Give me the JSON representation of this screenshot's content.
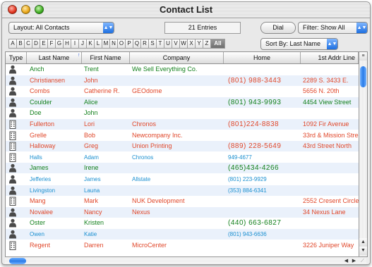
{
  "window": {
    "title": "Contact List"
  },
  "toolbar": {
    "layout_label": "Layout: All Contacts",
    "entries": "21 Entries",
    "dial_label": "Dial",
    "filter_label": "Filter: Show All",
    "sort_label": "Sort By: Last Name"
  },
  "alpha": [
    "A",
    "B",
    "C",
    "D",
    "E",
    "F",
    "G",
    "H",
    "I",
    "J",
    "K",
    "L",
    "M",
    "N",
    "O",
    "P",
    "Q",
    "R",
    "S",
    "T",
    "U",
    "V",
    "W",
    "X",
    "Y",
    "Z",
    "All"
  ],
  "columns": [
    "Type",
    "Last Name",
    "First Name",
    "Company",
    "Home",
    "1st Addr Line"
  ],
  "rows": [
    {
      "type": "person",
      "last": "Anch",
      "first": "Trent",
      "company": "We Sell Everything Co.",
      "home": "",
      "addr": "",
      "color": "#13801c"
    },
    {
      "type": "person",
      "last": "Christiansen",
      "first": "John",
      "company": "",
      "home": "(801) 988-3443",
      "addr": "2289 S. 3433 E.",
      "color": "#e0472a"
    },
    {
      "type": "person",
      "last": "Combs",
      "first": "Catherine R.",
      "company": "GEOdome",
      "home": "",
      "addr": "5656 N. 20th",
      "color": "#e0472a"
    },
    {
      "type": "person",
      "last": "Coulder",
      "first": "Alice",
      "company": "",
      "home": "(801) 943-9993",
      "addr": "4454 View Street",
      "color": "#13801c"
    },
    {
      "type": "person",
      "last": "Doe",
      "first": "John",
      "company": "",
      "home": "",
      "addr": "",
      "color": "#13801c"
    },
    {
      "type": "building",
      "last": "Fullerton",
      "first": "Lori",
      "company": "Chronos",
      "home": "(801)224-8838",
      "addr": "1092 Fir Avenue",
      "color": "#e0472a"
    },
    {
      "type": "building",
      "last": "Grelle",
      "first": "Bob",
      "company": "Newcompany Inc.",
      "home": "",
      "addr": "33rd & Mission Stree",
      "color": "#e0472a"
    },
    {
      "type": "building",
      "last": "Halloway",
      "first": "Greg",
      "company": "Union Printing",
      "home": "(889) 228-5649",
      "addr": "43rd Street North",
      "color": "#e0472a"
    },
    {
      "type": "building",
      "last": "Halls",
      "first": "Adam",
      "company": "Chronos",
      "home": "949-4677",
      "addr": "",
      "color": "#1a8fd0"
    },
    {
      "type": "person",
      "last": "James",
      "first": "Irene",
      "company": "",
      "home": "(465)434-4266",
      "addr": "",
      "color": "#13801c"
    },
    {
      "type": "person",
      "last": "Jefferies",
      "first": "James",
      "company": "Allstate",
      "home": "(801) 223-9929",
      "addr": "",
      "color": "#1a8fd0"
    },
    {
      "type": "person",
      "last": "Livingston",
      "first": "Launa",
      "company": "",
      "home": "(353) 884-6341",
      "addr": "",
      "color": "#1a8fd0"
    },
    {
      "type": "building",
      "last": "Mang",
      "first": "Mark",
      "company": "NUK Development",
      "home": "",
      "addr": "2552 Cresent Circle",
      "color": "#e0472a"
    },
    {
      "type": "person",
      "last": "Novalee",
      "first": "Nancy",
      "company": "Nexus",
      "home": "",
      "addr": "34 Nexus Lane",
      "color": "#e0472a"
    },
    {
      "type": "person",
      "last": "Oster",
      "first": "Kristen",
      "company": "",
      "home": "(440) 663-6827",
      "addr": "",
      "color": "#13801c"
    },
    {
      "type": "person",
      "last": "Owen",
      "first": "Katie",
      "company": "",
      "home": "(801) 943-6636",
      "addr": "",
      "color": "#1a8fd0"
    },
    {
      "type": "building",
      "last": "Regent",
      "first": "Darren",
      "company": "MicroCenter",
      "home": "",
      "addr": "3226 Juniper Way",
      "color": "#e0472a"
    }
  ]
}
